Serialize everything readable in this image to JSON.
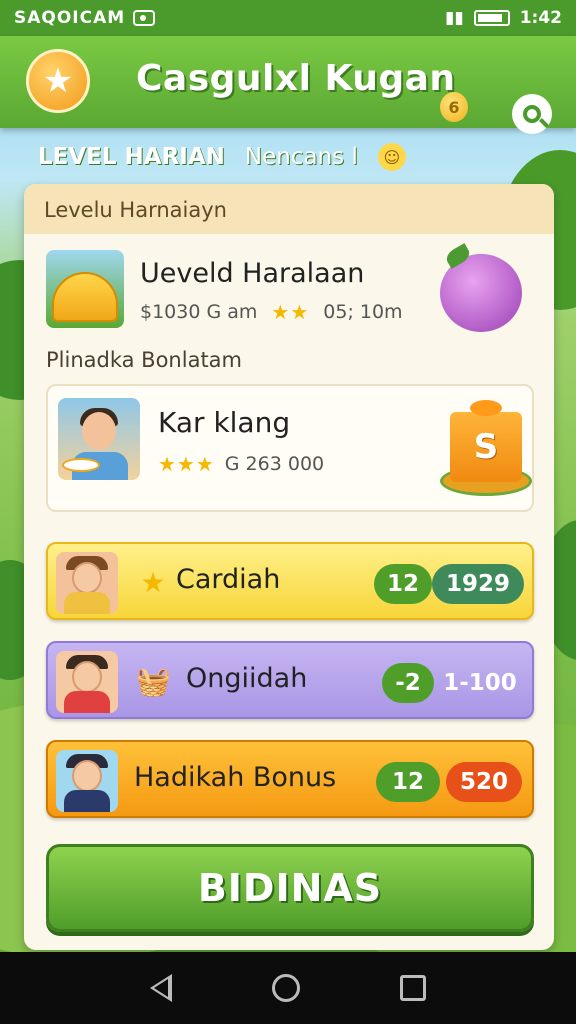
{
  "status_bar": {
    "carrier": "SAQOICAM",
    "time": "1:42"
  },
  "app": {
    "title": "Casgulxl Kugan",
    "coin_symbol": "6",
    "accent": "#5aa833"
  },
  "tabs": {
    "level": "LEVEL  HARIAN",
    "separator": "Nencans  l"
  },
  "panel": {
    "header": "Levelu Harnaiayn",
    "daily_item": {
      "title": "Ueveld Haralaan",
      "amount": "$1030 G  am",
      "stars": "★★",
      "time": "05; 10m"
    },
    "section_label": "Plinadka Bonlatam",
    "featured": {
      "title": "Kar klang",
      "stars": "★★★",
      "amount": "G 263 000",
      "gift_letter": "S"
    },
    "rows": [
      {
        "label": "Cardiah",
        "icon": "star-icon",
        "pill_left": "12",
        "pill_right": "1929",
        "pill_color": "#4f9e2a",
        "pill_right_color": "#3f8a5a"
      },
      {
        "label": "Ongiidah",
        "icon": "basket-icon",
        "pill_left": "-2",
        "pill_right": "1-100",
        "pill_color": "#4f9e2a",
        "pill_right_color": "#a996e6"
      },
      {
        "label": "Hadikah Bonus",
        "icon": "",
        "pill_left": "12",
        "pill_right": "520",
        "pill_color": "#4f9e2a",
        "pill_right_color": "#e8501a"
      }
    ],
    "cta_label": "BIDINAS"
  }
}
